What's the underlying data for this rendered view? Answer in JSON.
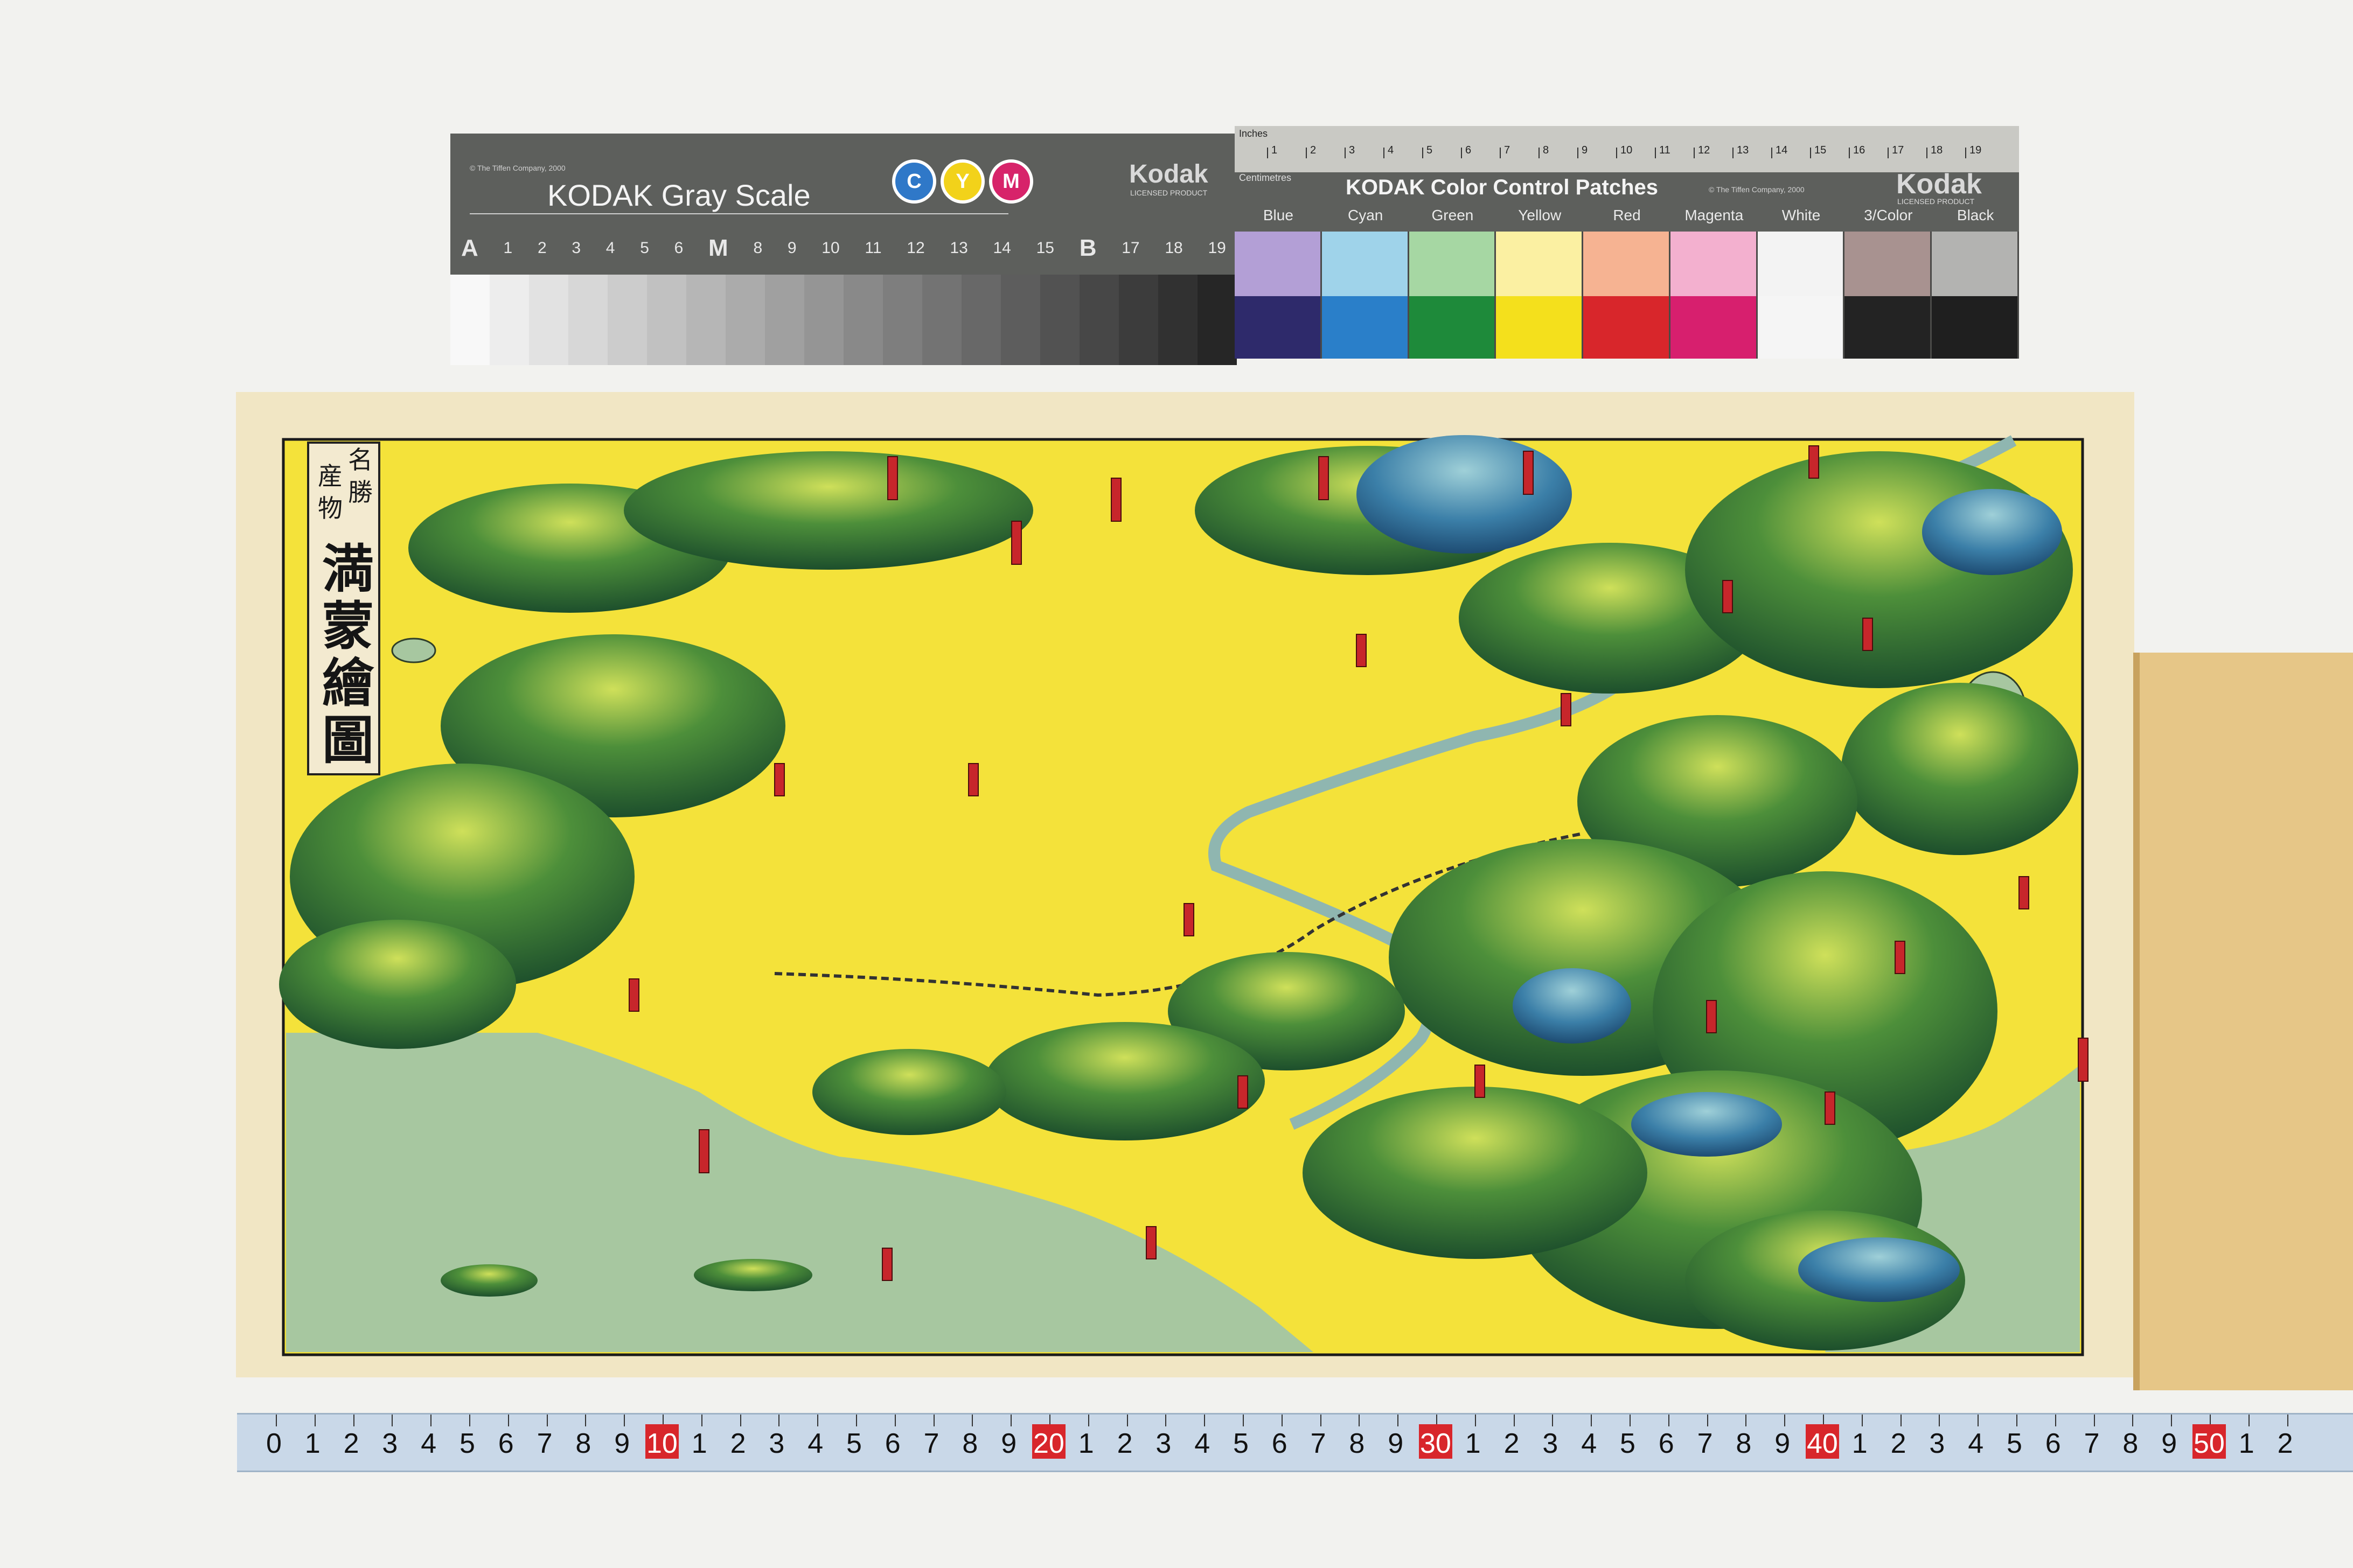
{
  "gray_card": {
    "copyright": "© The Tiffen Company, 2000",
    "title": "KODAK Gray Scale",
    "cym": [
      "C",
      "Y",
      "M"
    ],
    "brand": "Kodak",
    "licensed": "LICENSED PRODUCT",
    "steps": [
      "A",
      "1",
      "2",
      "3",
      "4",
      "5",
      "6",
      "M",
      "8",
      "9",
      "10",
      "11",
      "12",
      "13",
      "14",
      "15",
      "B",
      "17",
      "18",
      "19"
    ]
  },
  "color_card": {
    "inches_label": "Inches",
    "cm_label": "Centimetres",
    "title": "KODAK Color Control Patches",
    "copyright": "© The Tiffen Company, 2000",
    "brand": "Kodak",
    "licensed": "LICENSED PRODUCT",
    "patch_labels": [
      "Blue",
      "Cyan",
      "Green",
      "Yellow",
      "Red",
      "Magenta",
      "White",
      "3/Color",
      "Black"
    ],
    "ruler_numbers": [
      "1",
      "2",
      "3",
      "4",
      "5",
      "6",
      "7",
      "8",
      "9",
      "10",
      "11",
      "12",
      "13",
      "14",
      "15",
      "16",
      "17",
      "18",
      "19"
    ],
    "top_colors": [
      "#b39fd6",
      "#9fd3ea",
      "#a6d7a3",
      "#fbf0a2",
      "#f6b392",
      "#f3b0cf",
      "#f3f3f3",
      "#a89290",
      "#b3b3b1"
    ],
    "bottom_colors": [
      "#2e2a6b",
      "#2a7fc9",
      "#1e8a3a",
      "#f4e01c",
      "#d8262b",
      "#d71f6e",
      "#f5f5f5",
      "#232323",
      "#1f1f1f"
    ]
  },
  "map": {
    "title_sub_left": "名勝",
    "title_sub_right": "産物",
    "title_main": "満蒙繪圖"
  },
  "tape": {
    "numbers": [
      "0",
      "1",
      "2",
      "3",
      "4",
      "5",
      "6",
      "7",
      "8",
      "9",
      "10",
      "1",
      "2",
      "3",
      "4",
      "5",
      "6",
      "7",
      "8",
      "9",
      "20",
      "1",
      "2",
      "3",
      "4",
      "5",
      "6",
      "7",
      "8",
      "9",
      "30",
      "1",
      "2",
      "3",
      "4",
      "5",
      "6",
      "7",
      "8",
      "9",
      "40",
      "1",
      "2",
      "3",
      "4",
      "5",
      "6",
      "7",
      "8",
      "9",
      "50",
      "1",
      "2"
    ],
    "red_marks": [
      "10",
      "20",
      "30",
      "40",
      "50"
    ]
  }
}
